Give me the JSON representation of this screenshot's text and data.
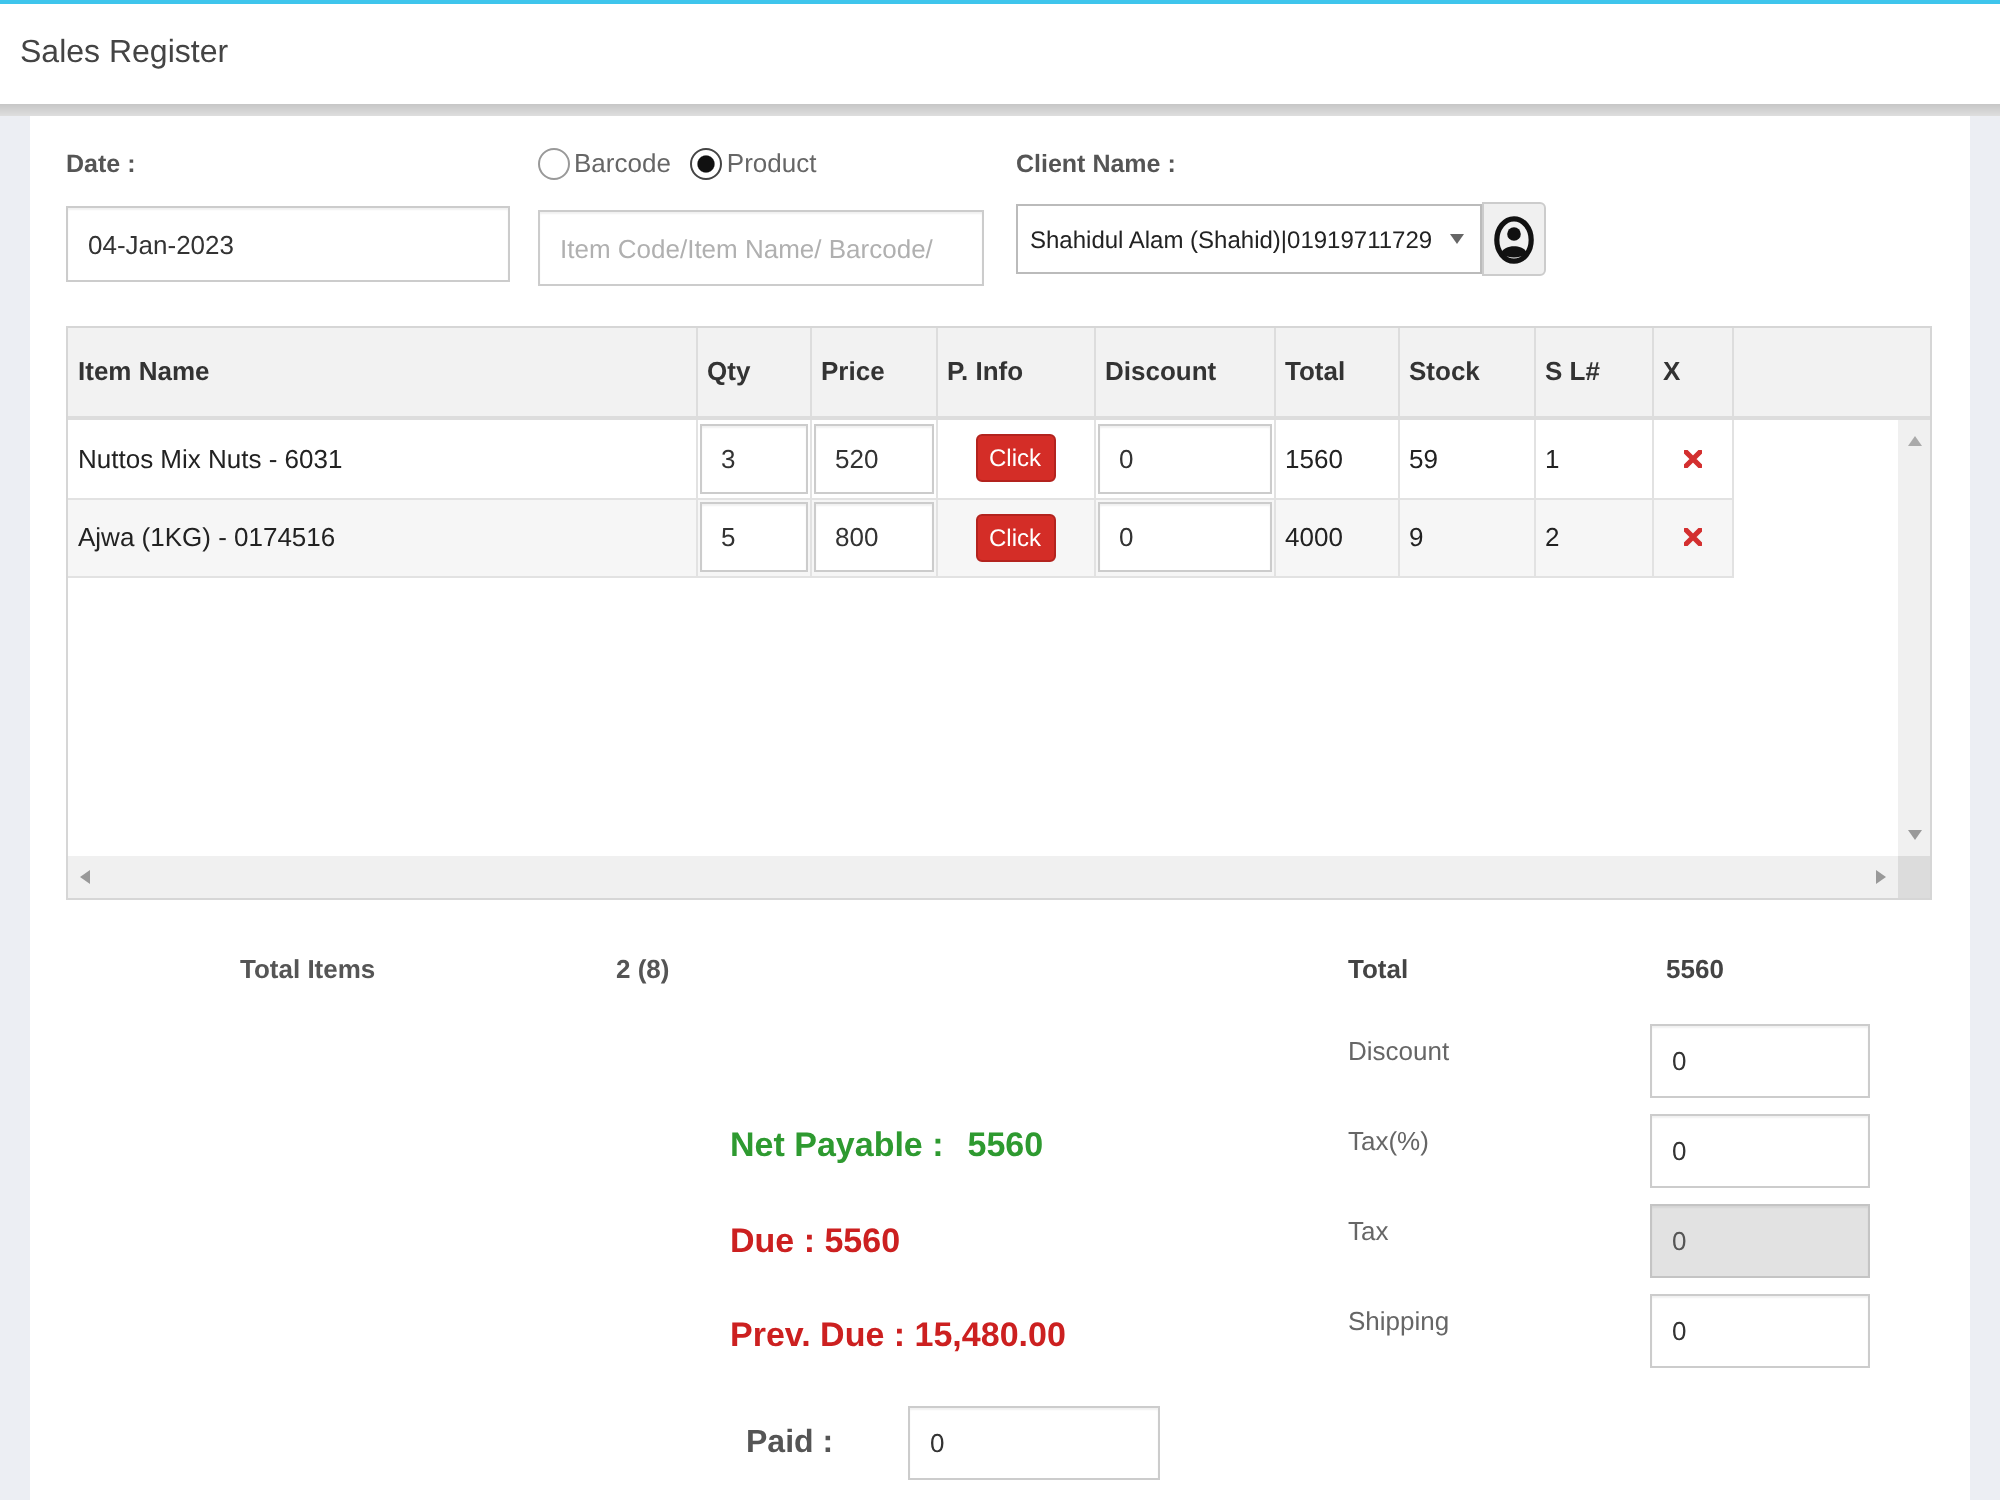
{
  "window": {
    "title": "Sales Register"
  },
  "form": {
    "date": {
      "label": "Date :",
      "value": "04-Jan-2023"
    },
    "search_mode": [
      {
        "label": "Barcode",
        "selected": false
      },
      {
        "label": "Product",
        "selected": true
      }
    ],
    "item_search": {
      "placeholder": "Item Code/Item Name/ Barcode/"
    },
    "client": {
      "label": "Client Name :",
      "value": "Shahidul Alam (Shahid)|01919711729"
    }
  },
  "table": {
    "columns": [
      {
        "label": "Item Name",
        "kind": "text"
      },
      {
        "label": "Qty",
        "kind": "input"
      },
      {
        "label": "Price",
        "kind": "input"
      },
      {
        "label": "P. Info",
        "kind": "button"
      },
      {
        "label": "Discount",
        "kind": "input"
      },
      {
        "label": "Total",
        "kind": "text"
      },
      {
        "label": "Stock",
        "kind": "text"
      },
      {
        "label": "S L#",
        "kind": "text"
      },
      {
        "label": "X",
        "kind": "delete"
      }
    ],
    "rows": [
      {
        "cells": [
          "Nuttos Mix Nuts - 6031",
          "3",
          "520",
          "Click",
          "0",
          "1560",
          "59",
          "1"
        ]
      },
      {
        "cells": [
          "Ajwa (1KG) - 0174516",
          "5",
          "800",
          "Click",
          "0",
          "4000",
          "9",
          "2"
        ]
      }
    ]
  },
  "summary": {
    "total_items": {
      "label": "Total Items",
      "value": "2 (8)"
    },
    "total": {
      "label": "Total",
      "value": "5560"
    },
    "adjustments": [
      {
        "label": "Discount",
        "value": "0",
        "disabled": false
      },
      {
        "label": "Tax(%)",
        "value": "0",
        "disabled": false
      },
      {
        "label": "Tax",
        "value": "0",
        "disabled": true
      },
      {
        "label": "Shipping",
        "value": "0",
        "disabled": false
      }
    ],
    "net_payable": {
      "label": "Net Payable :",
      "value": "5560"
    },
    "due": "Due : 5560",
    "previous_due": "Prev. Due : 15,480.00",
    "paid": {
      "label": "Paid :",
      "value": "0"
    }
  }
}
